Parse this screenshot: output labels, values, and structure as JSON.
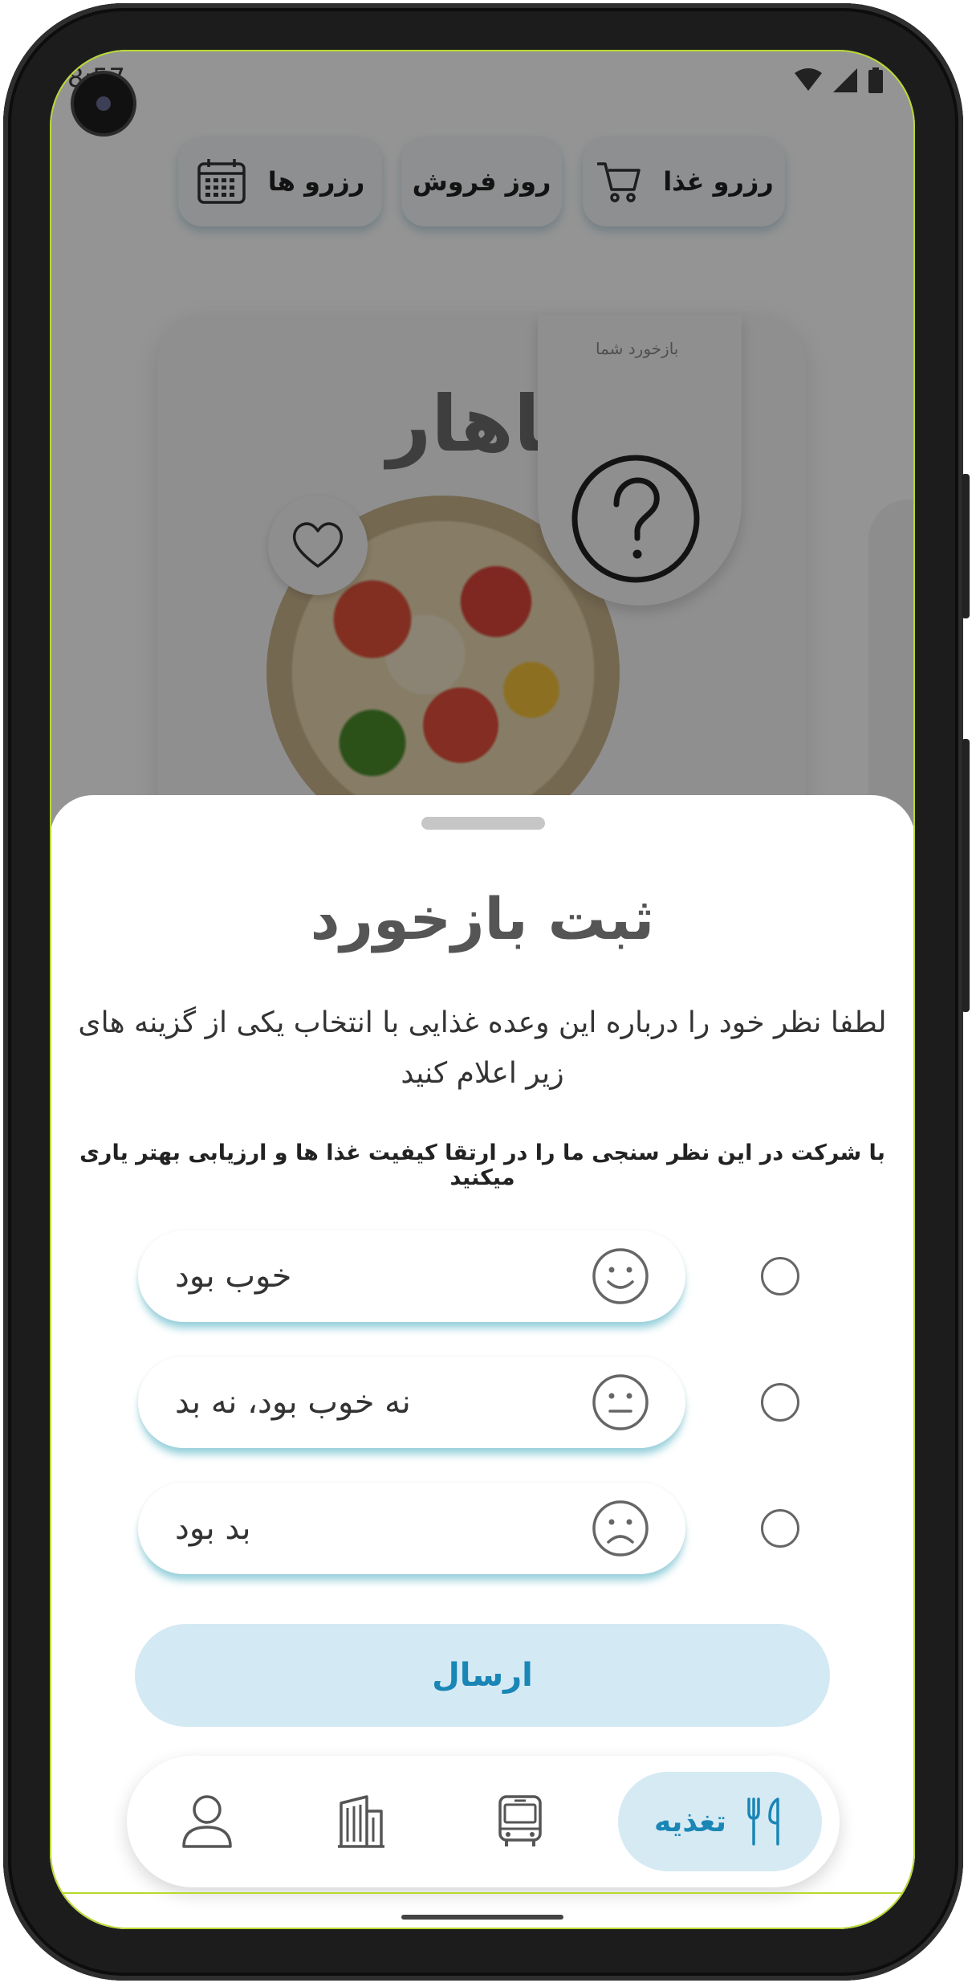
{
  "status_bar": {
    "time": "8:57"
  },
  "top_tabs": [
    {
      "label": "رزرو غذا",
      "icon": "cart-icon"
    },
    {
      "label": "روز فروش",
      "icon": ""
    },
    {
      "label": "رزرو ها",
      "icon": "calendar-icon"
    }
  ],
  "meal_card": {
    "title": "ناهار",
    "feedback_tab_label": "بازخورد شما",
    "favorite_icon": "heart-icon",
    "feedback_icon": "question-icon"
  },
  "sheet": {
    "title": "ثبت بازخورد",
    "description": "لطفا نظر خود را درباره این وعده غذایی با انتخاب یکی از گزینه های زیر اعلام کنید",
    "note": "با شرکت در این نظر سنجی ما را در ارتقا کیفیت غذا ها و ارزیابی بهتر یاری میکنید",
    "options": [
      {
        "label": "خوب بود",
        "icon": "smile-icon",
        "selected": false
      },
      {
        "label": "نه خوب بود، نه بد",
        "icon": "neutral-face-icon",
        "selected": false
      },
      {
        "label": "بد بود",
        "icon": "sad-face-icon",
        "selected": false
      }
    ],
    "submit_label": "ارسال"
  },
  "bottom_nav": {
    "items": [
      {
        "label": "تغذیه",
        "icon": "fork-knife-icon",
        "active": true
      },
      {
        "label": "",
        "icon": "bus-icon",
        "active": false
      },
      {
        "label": "",
        "icon": "building-icon",
        "active": false
      },
      {
        "label": "",
        "icon": "user-icon",
        "active": false
      }
    ]
  },
  "colors": {
    "accent": "#1a86b6",
    "accent_bg": "#d3e9f3",
    "frame_edge": "#b7d92e"
  }
}
